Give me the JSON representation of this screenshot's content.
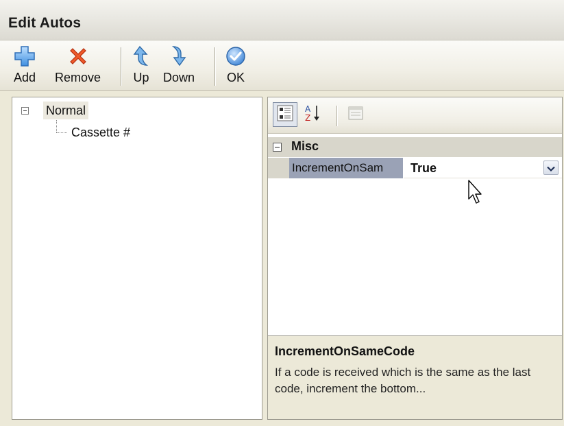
{
  "window": {
    "title": "Edit Autos"
  },
  "toolbar": {
    "buttons": [
      {
        "label": "Add",
        "icon": "add-plus-icon"
      },
      {
        "label": "Remove",
        "icon": "remove-x-icon"
      },
      {
        "label": "Up",
        "icon": "up-arrow-icon"
      },
      {
        "label": "Down",
        "icon": "down-arrow-icon"
      },
      {
        "label": "OK",
        "icon": "ok-check-icon"
      }
    ]
  },
  "tree": {
    "root": {
      "label": "Normal",
      "expanded": true,
      "selected": true
    },
    "children": [
      {
        "label": "Cassette #"
      }
    ]
  },
  "property_grid": {
    "toolbar": {
      "categorized_icon": "categorized-icon",
      "alphabetical_icon": "sort-az-icon",
      "property_pages_icon": "property-pages-icon"
    },
    "category": {
      "name": "Misc",
      "expanded": true
    },
    "properties": [
      {
        "name": "IncrementOnSam",
        "value": "True"
      }
    ],
    "description": {
      "title": "IncrementOnSameCode",
      "text": "If a code is received which is the same as the last code, increment the bottom..."
    }
  },
  "colors": {
    "window_bg": "#ece9d8",
    "selected_property_bg": "#9aa2b6",
    "category_bg": "#d8d6cb"
  }
}
